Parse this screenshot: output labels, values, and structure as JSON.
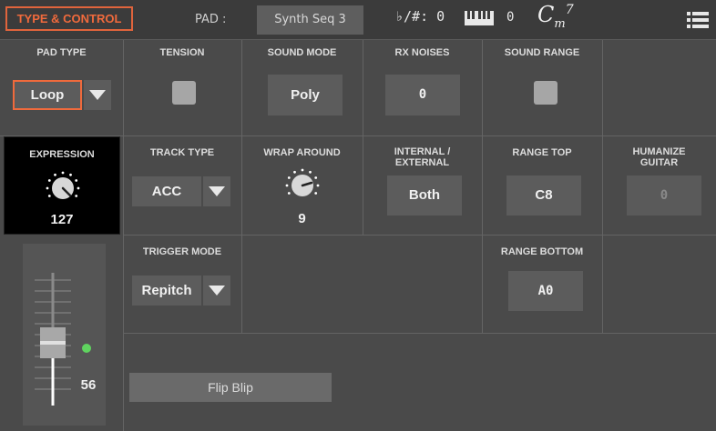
{
  "header": {
    "tab_title": "TYPE & CONTROL",
    "pad_label": "PAD :",
    "pad_value": "Synth Seq 3",
    "transpose": "♭/#: 0",
    "octave": "0",
    "chord_root": "C",
    "chord_sub": "m",
    "chord_sup": "7"
  },
  "params": {
    "pad_type": {
      "label": "PAD TYPE",
      "value": "Loop"
    },
    "tension": {
      "label": "TENSION",
      "checked": false
    },
    "sound_mode": {
      "label": "SOUND MODE",
      "value": "Poly"
    },
    "rx_noises": {
      "label": "RX NOISES",
      "value": "0"
    },
    "sound_range": {
      "label": "SOUND RANGE",
      "checked": false
    },
    "expression": {
      "label": "EXPRESSION",
      "value": "127"
    },
    "track_type": {
      "label": "TRACK TYPE",
      "value": "ACC"
    },
    "wrap_around": {
      "label": "WRAP AROUND",
      "value": "9"
    },
    "internal_external": {
      "label_line1": "INTERNAL /",
      "label_line2": "EXTERNAL",
      "value": "Both"
    },
    "range_top": {
      "label": "RANGE TOP",
      "value": "C8"
    },
    "humanize_guitar": {
      "label_line1": "HUMANIZE",
      "label_line2": "GUITAR",
      "value": "0"
    },
    "trigger_mode": {
      "label": "TRIGGER MODE",
      "value": "Repitch"
    },
    "range_bottom": {
      "label": "RANGE BOTTOM",
      "value": "A0"
    }
  },
  "fader": {
    "value": "56"
  },
  "flip_blip": {
    "label": "Flip Blip"
  },
  "colors": {
    "accent": "#f06a3c",
    "led": "#5fd35f",
    "background": "#4a4a4a"
  },
  "icons": [
    "keyboard-icon",
    "menu-icon",
    "knob-icon",
    "fader-icon"
  ]
}
